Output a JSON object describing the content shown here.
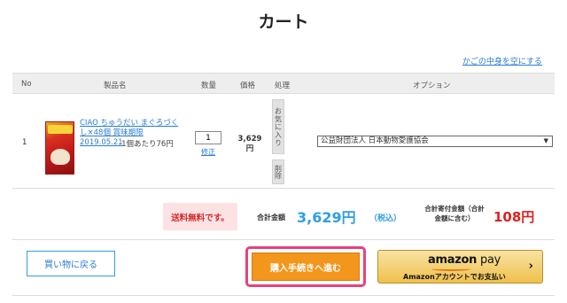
{
  "page": {
    "title": "カート"
  },
  "cart": {
    "empty_link": "かごの中身を空にする"
  },
  "table": {
    "headers": {
      "no": "No",
      "product": "製品名",
      "qty": "数量",
      "price": "価格",
      "action": "処理",
      "option": "オプション"
    },
    "rows": [
      {
        "no": "1",
        "product_name": "CIAO ちゅうだい まぐろづくし×48個 賞味期限2019.05.21",
        "unit_price": "-1個あたり76円",
        "quantity": "1",
        "qty_fix_label": "修正",
        "price": "3,629円",
        "favorite_label": "お気に入り",
        "delete_label": "削除",
        "option_selected": "公益財団法人 日本動物愛護協会"
      }
    ]
  },
  "summary": {
    "free_shipping": "送料無料です。",
    "total_label": "合計金額",
    "total_amount": "3,629円",
    "total_tax": "（税込）",
    "donation_label": "合計寄付金額（合計金額に含む）",
    "donation_amount": "108円"
  },
  "actions": {
    "back_label": "買い物に戻る",
    "checkout_label": "購入手続きへ進む",
    "amazon_logo": "amazon",
    "amazon_pay": "pay",
    "amazon_sub": "Amazonアカウントでお支払い"
  },
  "colors": {
    "accent_blue": "#2f9fe0",
    "checkout_orange": "#f3961c",
    "donation_red": "#e02020",
    "highlight_pink": "#e8417a"
  },
  "icons": {
    "select_arrow": "chevron-down-icon",
    "amazon_arrow": "chevron-right-icon"
  }
}
